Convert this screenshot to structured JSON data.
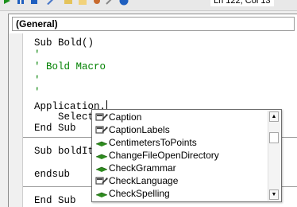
{
  "toolbar": {
    "status": "Ln 122, Col 13"
  },
  "window": {
    "object_combo": "(General)"
  },
  "code": {
    "lines": [
      "Sub Bold()",
      "'",
      "' Bold Macro",
      "'",
      "'",
      "Application.",
      "    Select",
      "End Sub",
      "Sub boldIt",
      "endsub",
      "End Sub"
    ]
  },
  "autocomplete": {
    "items": [
      {
        "label": "Caption",
        "icon": "property-icon"
      },
      {
        "label": "CaptionLabels",
        "icon": "property-icon"
      },
      {
        "label": "CentimetersToPoints",
        "icon": "method-icon"
      },
      {
        "label": "ChangeFileOpenDirectory",
        "icon": "method-icon"
      },
      {
        "label": "CheckGrammar",
        "icon": "method-icon"
      },
      {
        "label": "CheckLanguage",
        "icon": "property-icon"
      },
      {
        "label": "CheckSpelling",
        "icon": "method-icon"
      }
    ]
  },
  "colors": {
    "comment": "#008000",
    "method_icon": "#2e8b1f",
    "property_icon": "#4a4a4a"
  }
}
